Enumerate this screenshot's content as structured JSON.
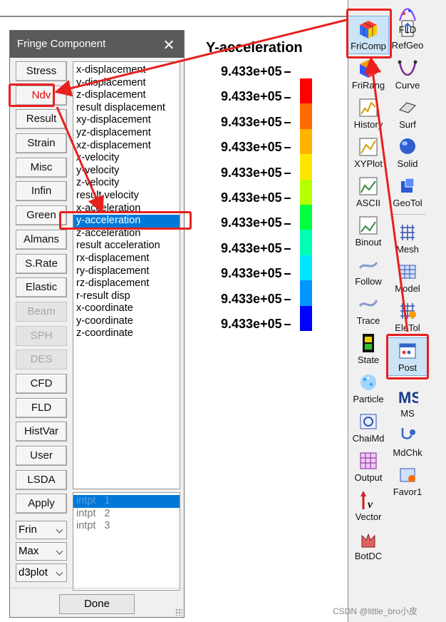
{
  "dialog": {
    "title": "Fringe Component",
    "buttons": [
      {
        "label": "Stress",
        "state": "normal"
      },
      {
        "label": "Ndv",
        "state": "highlight"
      },
      {
        "label": "Result",
        "state": "normal"
      },
      {
        "label": "Strain",
        "state": "normal"
      },
      {
        "label": "Misc",
        "state": "normal"
      },
      {
        "label": "Infin",
        "state": "normal"
      },
      {
        "label": "Green",
        "state": "normal"
      },
      {
        "label": "Almans",
        "state": "normal"
      },
      {
        "label": "S.Rate",
        "state": "normal"
      },
      {
        "label": "Elastic",
        "state": "normal"
      },
      {
        "label": "Beam",
        "state": "disabled"
      },
      {
        "label": "SPH",
        "state": "disabled"
      },
      {
        "label": "DES",
        "state": "disabled"
      },
      {
        "label": "CFD",
        "state": "normal"
      },
      {
        "label": "FLD",
        "state": "normal"
      },
      {
        "label": "HistVar",
        "state": "normal"
      },
      {
        "label": "User",
        "state": "normal"
      },
      {
        "label": "LSDA",
        "state": "normal"
      },
      {
        "label": "Apply",
        "state": "normal"
      }
    ],
    "dropdowns": [
      "Frin",
      "Max",
      "d3plot"
    ],
    "components": [
      "x-displacement",
      "y-displacement",
      "z-displacement",
      "result displacement",
      "xy-displacement",
      "yz-displacement",
      "xz-displacement",
      "x-velocity",
      "y-velocity",
      "z-velocity",
      "result velocity",
      "x-acceleration",
      "y-acceleration",
      "z-acceleration",
      "result acceleration",
      "rx-displacement",
      "ry-displacement",
      "rz-displacement",
      "r-result disp",
      "x-coordinate",
      "y-coordinate",
      "z-coordinate"
    ],
    "selected_component": "y-acceleration",
    "intpts": [
      {
        "label": "intpt",
        "num": "1"
      },
      {
        "label": "intpt",
        "num": "2"
      },
      {
        "label": "intpt",
        "num": "3"
      }
    ],
    "selected_intpt": 0,
    "done_label": "Done"
  },
  "legend": {
    "title": "Y-acceleration",
    "labels": [
      "9.433e+05",
      "9.433e+05",
      "9.433e+05",
      "9.433e+05",
      "9.433e+05",
      "9.433e+05",
      "9.433e+05",
      "9.433e+05",
      "9.433e+05",
      "9.433e+05",
      "9.433e+05"
    ],
    "colors": [
      "#ff0000",
      "#ff6a00",
      "#ffb400",
      "#ffe600",
      "#b4ff00",
      "#00ff3c",
      "#00ffb4",
      "#00e6ff",
      "#0096ff",
      "#0000ff"
    ]
  },
  "toolbar": {
    "items": [
      {
        "label": "FriComp",
        "icon": "fringe-cube-icon",
        "active": true
      },
      {
        "label": "RefGeo",
        "icon": "refgeo-icon"
      },
      {
        "label": "FriRang",
        "icon": "fringe-range-cube-icon"
      },
      {
        "label": "Curve",
        "icon": "curve-icon"
      },
      {
        "label": "History",
        "icon": "history-plot-icon"
      },
      {
        "label": "Surf",
        "icon": "surface-icon"
      },
      {
        "label": "XYPlot",
        "icon": "xyplot-icon"
      },
      {
        "label": "Solid",
        "icon": "solid-sphere-icon"
      },
      {
        "label": "ASCII",
        "icon": "ascii-icon"
      },
      {
        "label": "GeoTol",
        "icon": "geotol-icon"
      },
      {
        "label": "Binout",
        "icon": "binout-icon"
      },
      {
        "label": "Mesh",
        "icon": "mesh-icon"
      },
      {
        "label": "Follow",
        "icon": "follow-icon"
      },
      {
        "label": "Model",
        "icon": "model-icon"
      },
      {
        "label": "Trace",
        "icon": "trace-icon"
      },
      {
        "label": "EleTol",
        "icon": "eletol-icon"
      },
      {
        "label": "State",
        "icon": "film-state-icon"
      },
      {
        "label": "Post",
        "icon": "post-icon",
        "active": true
      },
      {
        "label": "Particle",
        "icon": "particle-icon"
      },
      {
        "label": "MS",
        "icon": "ms-icon"
      },
      {
        "label": "ChaiMd",
        "icon": "chaimd-icon"
      },
      {
        "label": "MdChk",
        "icon": "stethoscope-icon"
      },
      {
        "label": "Output",
        "icon": "output-icon"
      },
      {
        "label": "Favor1",
        "icon": "favorite-icon"
      },
      {
        "label": "Vector",
        "icon": "vector-icon"
      },
      {
        "label": "FLD",
        "icon": "fld-icon"
      },
      {
        "label": "BotDC",
        "icon": "botdc-icon"
      }
    ]
  },
  "watermark": "CSDN @little_bro小皮",
  "colors": {
    "annotation": "#e8201e",
    "selection": "#0078d7"
  }
}
